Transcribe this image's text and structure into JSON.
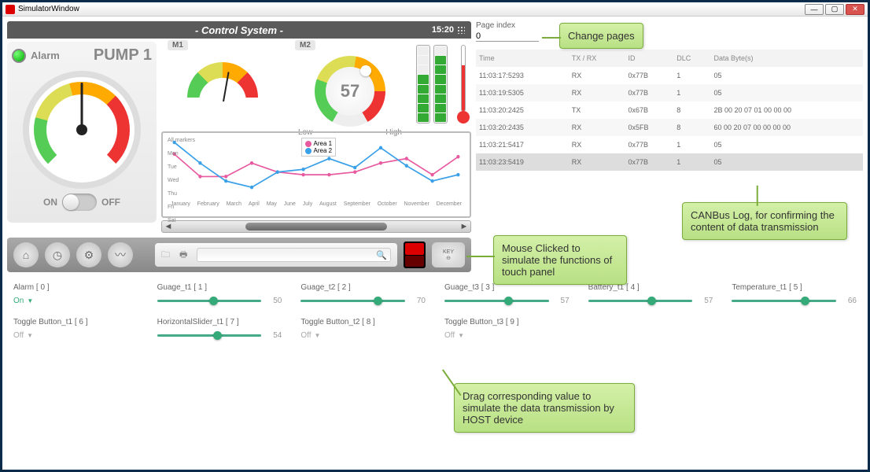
{
  "window": {
    "title": "SimulatorWindow"
  },
  "header": {
    "title": "- Control System -",
    "time": "15:20"
  },
  "alarm": {
    "label": "Alarm",
    "pump": "PUMP 1",
    "on": "ON",
    "off": "OFF"
  },
  "gauges": {
    "m1": "M1",
    "m2": "M2",
    "value": "57",
    "low": "Low",
    "high": "High"
  },
  "chart_data": {
    "type": "line",
    "categories": [
      "January",
      "February",
      "March",
      "April",
      "May",
      "June",
      "July",
      "August",
      "September",
      "October",
      "November",
      "December"
    ],
    "series": [
      {
        "name": "Area 1",
        "color": "#e85aa0",
        "values": [
          65,
          40,
          40,
          55,
          45,
          42,
          42,
          45,
          55,
          60,
          42,
          62
        ]
      },
      {
        "name": "Area 2",
        "color": "#3aa0e8",
        "values": [
          78,
          55,
          35,
          28,
          45,
          48,
          60,
          50,
          72,
          52,
          35,
          42
        ]
      }
    ],
    "y_ticks": [
      "All markers",
      "Mon",
      "Tue",
      "Wed",
      "Thu",
      "Fri",
      "Sat"
    ],
    "ylim": [
      20,
      80
    ]
  },
  "toolbar": {
    "icons": [
      "home-icon",
      "dashboard-icon",
      "gear-icon",
      "chart-icon"
    ],
    "key_label": "KEY"
  },
  "page_index": {
    "label": "Page index",
    "value": "0"
  },
  "log": {
    "headers": [
      "Time",
      "TX / RX",
      "ID",
      "DLC",
      "Data Byte(s)"
    ],
    "rows": [
      {
        "time": "11:03:17:5293",
        "dir": "RX",
        "id": "0x77B",
        "dlc": "1",
        "data": "05"
      },
      {
        "time": "11:03:19:5305",
        "dir": "RX",
        "id": "0x77B",
        "dlc": "1",
        "data": "05"
      },
      {
        "time": "11:03:20:2425",
        "dir": "TX",
        "id": "0x67B",
        "dlc": "8",
        "data": "2B 00 20 07 01 00 00 00"
      },
      {
        "time": "11:03:20:2435",
        "dir": "RX",
        "id": "0x5FB",
        "dlc": "8",
        "data": "60 00 20 07 00 00 00 00"
      },
      {
        "time": "11:03:21:5417",
        "dir": "RX",
        "id": "0x77B",
        "dlc": "1",
        "data": "05"
      },
      {
        "time": "11:03:23:5419",
        "dir": "RX",
        "id": "0x77B",
        "dlc": "1",
        "data": "05"
      }
    ]
  },
  "callouts": {
    "change_pages": "Change pages",
    "mouse_click": "Mouse Clicked to simulate the functions of touch panel",
    "canbus": "CANBus Log, for confirming the content of data transmission",
    "drag": "Drag corresponding value to simulate the data transmission by HOST device"
  },
  "controls": [
    {
      "label": "Alarm  [ 0 ]",
      "type": "dd",
      "value": "On"
    },
    {
      "label": "Guage_t1  [ 1 ]",
      "type": "slider",
      "value": 50,
      "pos": 50
    },
    {
      "label": "Guage_t2  [ 2 ]",
      "type": "slider",
      "value": 70,
      "pos": 70
    },
    {
      "label": "Guage_t3  [ 3 ]",
      "type": "slider",
      "value": 57,
      "pos": 57
    },
    {
      "label": "Battery_t1  [ 4 ]",
      "type": "slider",
      "value": 57,
      "pos": 57
    },
    {
      "label": "Temperature_t1  [ 5 ]",
      "type": "slider",
      "value": 66,
      "pos": 66
    },
    {
      "label": "Toggle Button_t1  [ 6 ]",
      "type": "ddg",
      "value": "Off"
    },
    {
      "label": "HorizontalSlider_t1  [ 7 ]",
      "type": "slider",
      "value": 54,
      "pos": 54
    },
    {
      "label": "Toggle Button_t2  [ 8 ]",
      "type": "ddg",
      "value": "Off"
    },
    {
      "label": "Toggle Button_t3  [ 9 ]",
      "type": "ddg",
      "value": "Off"
    }
  ]
}
